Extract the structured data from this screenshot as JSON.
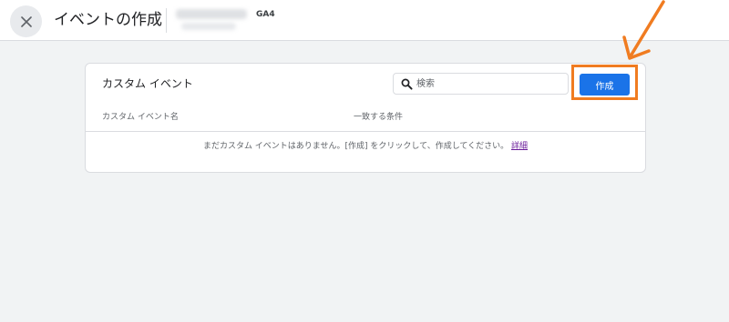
{
  "topbar": {
    "close_icon": "close-icon",
    "title": "イベントの作成",
    "property_tag": "GA4"
  },
  "card": {
    "title": "カスタム イベント",
    "search": {
      "placeholder": "検索",
      "value": "",
      "icon": "search-icon"
    },
    "create_label": "作成",
    "columns": [
      "カスタム イベント名",
      "一致する条件"
    ],
    "empty_message": "まだカスタム イベントはありません。[作成] をクリックして、作成してください。",
    "details_link": "詳細"
  },
  "annotation": {
    "color": "#f07c21",
    "icon": "arrow-icon"
  },
  "colors": {
    "accent": "#1a73e8",
    "background": "#f1f3f4",
    "link_visited": "#6a1b9a"
  }
}
